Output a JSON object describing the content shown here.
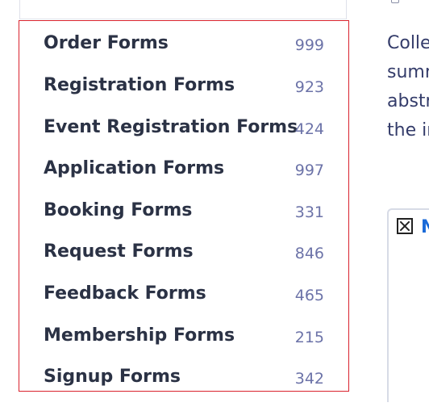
{
  "categories": [
    {
      "name": "Order Forms",
      "count": "999"
    },
    {
      "name": "Registration Forms",
      "count": "923"
    },
    {
      "name": "Event Registration Forms",
      "count": "424"
    },
    {
      "name": "Application Forms",
      "count": "997"
    },
    {
      "name": "Booking Forms",
      "count": "331"
    },
    {
      "name": "Request Forms",
      "count": "846"
    },
    {
      "name": "Feedback Forms",
      "count": "465"
    },
    {
      "name": "Membership Forms",
      "count": "215"
    },
    {
      "name": "Signup Forms",
      "count": "342"
    }
  ],
  "description_lines": [
    "Colle",
    "sumn",
    "abstr",
    "the ir"
  ],
  "card": {
    "link_text": "N"
  },
  "colors": {
    "highlight_border": "#d9232e",
    "count_text": "#6c73a8",
    "name_text": "#2b3245",
    "link": "#1a6ad8"
  }
}
